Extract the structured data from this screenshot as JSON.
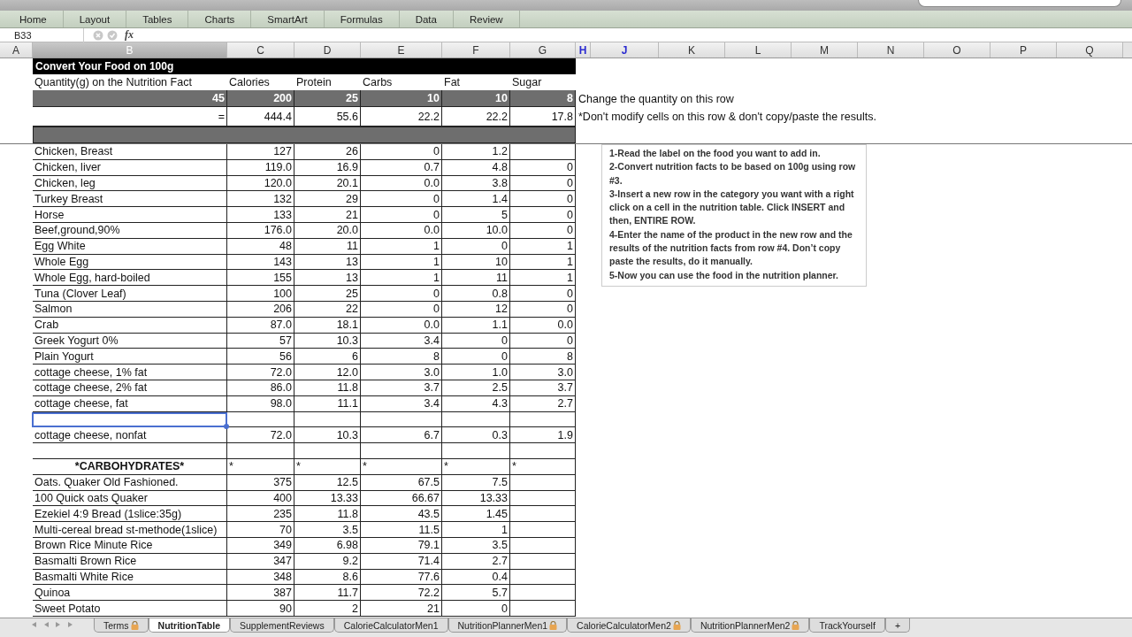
{
  "ribbon_tabs": [
    {
      "label": "Home",
      "selected": false
    },
    {
      "label": "Layout",
      "selected": false
    },
    {
      "label": "Tables",
      "selected": false
    },
    {
      "label": "Charts",
      "selected": false
    },
    {
      "label": "SmartArt",
      "selected": false
    },
    {
      "label": "Formulas",
      "selected": false
    },
    {
      "label": "Data",
      "selected": false
    },
    {
      "label": "Review",
      "selected": false
    }
  ],
  "name_box": "B33",
  "formula_symbol": "fx",
  "columns": [
    {
      "label": "A",
      "selected": false,
      "hidden_gap": false
    },
    {
      "label": "B",
      "selected": true,
      "hidden_gap": false
    },
    {
      "label": "C",
      "selected": false,
      "hidden_gap": false
    },
    {
      "label": "D",
      "selected": false,
      "hidden_gap": false
    },
    {
      "label": "E",
      "selected": false,
      "hidden_gap": false
    },
    {
      "label": "F",
      "selected": false,
      "hidden_gap": false
    },
    {
      "label": "G",
      "selected": false,
      "hidden_gap": false
    },
    {
      "label": "H",
      "selected": false,
      "hidden_gap": true
    },
    {
      "label": "J",
      "selected": false,
      "hidden_gap": true
    },
    {
      "label": "K",
      "selected": false,
      "hidden_gap": false
    },
    {
      "label": "L",
      "selected": false,
      "hidden_gap": false
    },
    {
      "label": "M",
      "selected": false,
      "hidden_gap": false
    },
    {
      "label": "N",
      "selected": false,
      "hidden_gap": false
    },
    {
      "label": "O",
      "selected": false,
      "hidden_gap": false
    },
    {
      "label": "P",
      "selected": false,
      "hidden_gap": false
    },
    {
      "label": "Q",
      "selected": false,
      "hidden_gap": false
    }
  ],
  "converter": {
    "title": "Convert Your Food on 100g",
    "labels": [
      "Quantity(g) on the Nutrition Fact",
      "Calories",
      "Protein",
      "Carbs",
      "Fat",
      "Sugar"
    ],
    "quantity_row": [
      "45",
      "200",
      "25",
      "10",
      "10",
      "8"
    ],
    "quantity_note": "Change the quantity on this row",
    "result_row": [
      "=",
      "444.4",
      "55.6",
      "22.2",
      "22.2",
      "17.8"
    ],
    "result_note": "*Don't modify cells on this row & don't copy/paste the results."
  },
  "rows": [
    {
      "kind": "food",
      "selected": false,
      "cells": [
        "Chicken, Breast",
        "127",
        "26",
        "0",
        "1.2"
      ]
    },
    {
      "kind": "food",
      "selected": false,
      "cells": [
        "Chicken, liver",
        "119.0",
        "16.9",
        "0.7",
        "4.8",
        "0"
      ]
    },
    {
      "kind": "food",
      "selected": false,
      "cells": [
        "Chicken, leg",
        "120.0",
        "20.1",
        "0.0",
        "3.8",
        "0"
      ]
    },
    {
      "kind": "food",
      "selected": false,
      "cells": [
        "Turkey Breast",
        "132",
        "29",
        "0",
        "1.4",
        "0"
      ]
    },
    {
      "kind": "food",
      "selected": false,
      "cells": [
        "Horse",
        "133",
        "21",
        "0",
        "5",
        "0"
      ]
    },
    {
      "kind": "food",
      "selected": false,
      "cells": [
        "Beef,ground,90%",
        "176.0",
        "20.0",
        "0.0",
        "10.0",
        "0"
      ]
    },
    {
      "kind": "food",
      "selected": false,
      "cells": [
        "Egg White",
        "48",
        "11",
        "1",
        "0",
        "1"
      ]
    },
    {
      "kind": "food",
      "selected": false,
      "cells": [
        "Whole Egg",
        "143",
        "13",
        "1",
        "10",
        "1"
      ]
    },
    {
      "kind": "food",
      "selected": false,
      "cells": [
        "Whole Egg, hard-boiled",
        "155",
        "13",
        "1",
        "11",
        "1"
      ]
    },
    {
      "kind": "food",
      "selected": false,
      "cells": [
        "Tuna (Clover Leaf)",
        "100",
        "25",
        "0",
        "0.8",
        "0"
      ]
    },
    {
      "kind": "food",
      "selected": false,
      "cells": [
        "Salmon",
        "206",
        "22",
        "0",
        "12",
        "0"
      ]
    },
    {
      "kind": "food",
      "selected": false,
      "cells": [
        "Crab",
        "87.0",
        "18.1",
        "0.0",
        "1.1",
        "0.0"
      ]
    },
    {
      "kind": "food",
      "selected": false,
      "cells": [
        "Greek Yogurt 0%",
        "57",
        "10.3",
        "3.4",
        "0",
        "0"
      ]
    },
    {
      "kind": "food",
      "selected": false,
      "cells": [
        "Plain Yogurt",
        "56",
        "6",
        "8",
        "0",
        "8"
      ]
    },
    {
      "kind": "food",
      "selected": false,
      "cells": [
        "cottage cheese, 1% fat",
        "72.0",
        "12.0",
        "3.0",
        "1.0",
        "3.0"
      ]
    },
    {
      "kind": "food",
      "selected": false,
      "cells": [
        "cottage cheese, 2% fat",
        "86.0",
        "11.8",
        "3.7",
        "2.5",
        "3.7"
      ]
    },
    {
      "kind": "food",
      "selected": false,
      "cells": [
        "cottage cheese, fat",
        "98.0",
        "11.1",
        "3.4",
        "4.3",
        "2.7"
      ]
    },
    {
      "kind": "blank",
      "selected": true
    },
    {
      "kind": "food",
      "selected": false,
      "cells": [
        "cottage cheese, nonfat",
        "72.0",
        "10.3",
        "6.7",
        "0.3",
        "1.9"
      ]
    },
    {
      "kind": "blank",
      "selected": false
    },
    {
      "kind": "category",
      "selected": false,
      "cells": [
        "*CARBOHYDRATES*",
        "*",
        "*",
        "*",
        "*",
        "*"
      ]
    },
    {
      "kind": "food",
      "selected": false,
      "cells": [
        "Oats. Quaker Old Fashioned.",
        "375",
        "12.5",
        "67.5",
        "7.5"
      ]
    },
    {
      "kind": "food",
      "selected": false,
      "cells": [
        "100 Quick oats Quaker",
        "400",
        "13.33",
        "66.67",
        "13.33"
      ]
    },
    {
      "kind": "food",
      "selected": false,
      "cells": [
        "Ezekiel 4:9 Bread (1slice:35g)",
        "235",
        "11.8",
        "43.5",
        "1.45"
      ]
    },
    {
      "kind": "food",
      "selected": false,
      "cells": [
        "Multi-cereal bread st-methode(1slice)",
        "70",
        "3.5",
        "11.5",
        "1"
      ]
    },
    {
      "kind": "food",
      "selected": false,
      "cells": [
        "Brown Rice Minute Rice",
        "349",
        "6.98",
        "79.1",
        "3.5"
      ]
    },
    {
      "kind": "food",
      "selected": false,
      "cells": [
        "Basmalti Brown Rice",
        "347",
        "9.2",
        "71.4",
        "2.7"
      ]
    },
    {
      "kind": "food",
      "selected": false,
      "cells": [
        "Basmalti White Rice",
        "348",
        "8.6",
        "77.6",
        "0.4"
      ]
    },
    {
      "kind": "food",
      "selected": false,
      "cells": [
        "Quinoa",
        "387",
        "11.7",
        "72.2",
        "5.7"
      ]
    },
    {
      "kind": "food",
      "selected": false,
      "cells": [
        "Sweet Potato",
        "90",
        "2",
        "21",
        "0"
      ]
    }
  ],
  "instructions": [
    "1-Read the label on the food you want to add in.",
    "2-Convert nutrition facts to be based on 100g using row #3.",
    "3-Insert a new row in the category you want with a right click on a cell in the nutrition table. Click INSERT and then, ENTIRE ROW.",
    "4-Enter the name of the product in the new row and the results of the nutrition facts from row #4. Don’t copy paste the results, do it manually.",
    "5-Now you can use the food in the nutrition planner."
  ],
  "sheet_tabs": [
    {
      "label": "Terms",
      "selected": false,
      "locked": true
    },
    {
      "label": "NutritionTable",
      "selected": true,
      "locked": false
    },
    {
      "label": "SupplementReviews",
      "selected": false,
      "locked": false
    },
    {
      "label": "CalorieCalculatorMen1",
      "selected": false,
      "locked": false
    },
    {
      "label": "NutritionPlannerMen1",
      "selected": false,
      "locked": true
    },
    {
      "label": "CalorieCalculatorMen2",
      "selected": false,
      "locked": true
    },
    {
      "label": "NutritionPlannerMen2",
      "selected": false,
      "locked": true
    },
    {
      "label": "TrackYourself",
      "selected": false,
      "locked": false
    }
  ],
  "add_sheet": "+"
}
